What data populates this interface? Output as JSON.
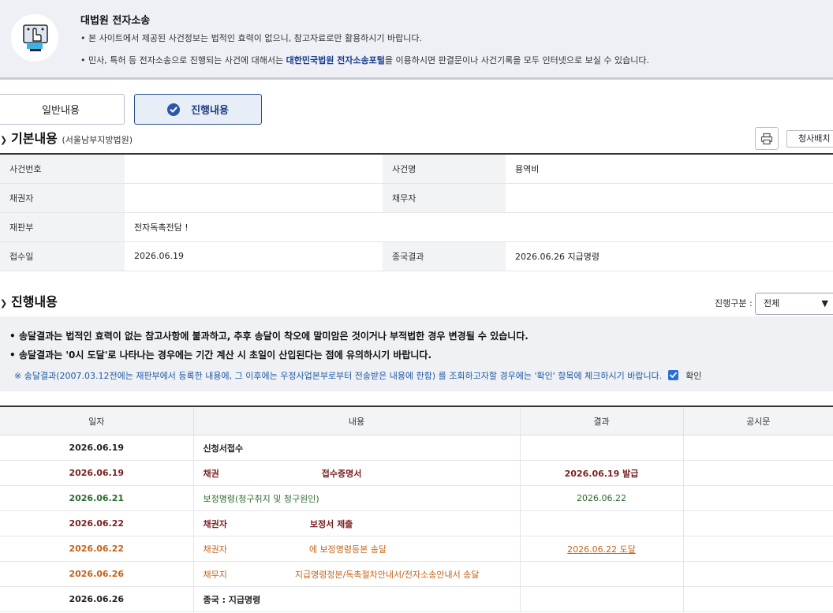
{
  "notice": {
    "title": "대법원 전자소송",
    "line1": "본 사이트에서 제공된 사건정보는 법적인 효력이 없으니, 참고자료로만 활용하시기 바랍니다.",
    "line2_pre": "민사, 특허 등 전자소송으로 진행되는 사건에 대해서는 ",
    "line2_link": "대한민국법원 전자소송포털",
    "line2_post": "을 이용하시면 판결문이나 사건기록을 모두 인터넷으로 보실 수 있습니다."
  },
  "tabs": [
    {
      "label": "일반내용",
      "active": false
    },
    {
      "label": "진행내용",
      "active": true
    }
  ],
  "basic": {
    "title": "기본내용",
    "court": "(서울남부지방법원)",
    "print_icon": "printer-icon",
    "court_button": "청사배치",
    "rows": [
      {
        "l1": "사건번호",
        "v1": "",
        "l2": "사건명",
        "v2": "용역비"
      },
      {
        "l1": "채권자",
        "v1": "",
        "l2": "채무자",
        "v2": ""
      },
      {
        "l1": "재판부",
        "v1": "전자독촉전담 !",
        "l2": "",
        "v2": ""
      },
      {
        "l1": "접수일",
        "v1": "2026.06.19",
        "l2": "종국결과",
        "v2": "2026.06.26 지급명령"
      }
    ]
  },
  "progress": {
    "title": "진행내용",
    "filter_label": "진행구분 :",
    "filter_value": "전체",
    "guide1": "송달결과는 법적인 효력이 없는 참고사항에 불과하고, 추후 송달이 착오에 말미암은 것이거나 부적법한 경우 변경될 수 있습니다.",
    "guide2": "송달결과는 '0시 도달'로 나타나는 경우에는 기간 계산 시 초일이 산입된다는 점에 유의하시기 바랍니다.",
    "note": "※ 송달결과(2007.03.12전에는 재판부에서 등록한 내용에, 그 이후에는 우정사업본부로부터 전송받은 내용에 한함) 를 조회하고자할 경우에는 '확인' 항목에 체크하시기 바랍니다.",
    "confirm_label": "확인",
    "headers": [
      "일자",
      "내용",
      "결과",
      "공시문"
    ],
    "rows": [
      {
        "date": "2026.06.19",
        "content_a": "신청서접수",
        "content_b": "",
        "result": "",
        "color": "#222222"
      },
      {
        "date": "2026.06.19",
        "content_a": "채권",
        "content_b": "접수증명서",
        "result": "2026.06.19 발급",
        "color": "#7a1f1f"
      },
      {
        "date": "2026.06.21",
        "content_a": "보정명령(청구취지 및 청구원인)",
        "content_b": "",
        "result": "2026.06.22",
        "color": "#2f6b2f"
      },
      {
        "date": "2026.06.22",
        "content_a": "채권자",
        "content_b": "보정서 제출",
        "result": "",
        "color": "#7a1f1f"
      },
      {
        "date": "2026.06.22",
        "content_a": "채권자",
        "content_b": "에 보정명령등본 송달",
        "result": "2026.06.22 도달",
        "color": "#c2641a"
      },
      {
        "date": "2026.06.26",
        "content_a": "채무지",
        "content_b": "지급명령정본/독촉절차안내서/전자소송안내서 송달",
        "result": "",
        "color": "#c2641a"
      },
      {
        "date": "2026.06.26",
        "content_a": "종국 : 지급명령",
        "content_b": "",
        "result": "",
        "color": "#222222"
      }
    ]
  }
}
